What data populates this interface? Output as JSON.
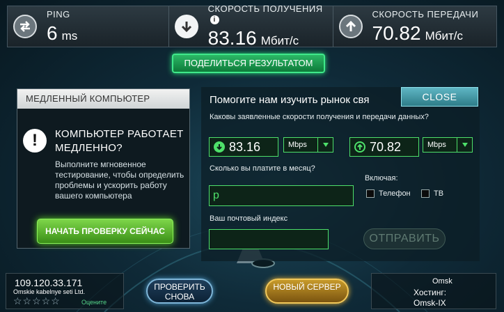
{
  "top": {
    "ping": {
      "label": "PING",
      "value": "6",
      "unit": "ms"
    },
    "download": {
      "label": "СКОРОСТЬ ПОЛУЧЕНИЯ",
      "value": "83.16",
      "unit": "Мбит/с",
      "info": "i"
    },
    "upload": {
      "label": "СКОРОСТЬ ПЕРЕДАЧИ",
      "value": "70.82",
      "unit": "Мбит/с"
    }
  },
  "share_label": "ПОДЕЛИТЬСЯ РЕЗУЛЬТАТОМ",
  "slow_panel": {
    "header": "МЕДЛЕННЫЙ КОМПЬЮТЕР",
    "alert_glyph": "!",
    "title": "КОМПЬЮТЕР РАБОТАЕТ МЕДЛЕННО?",
    "description": "Выполните мгновенное тестирование, чтобы определить проблемы и ускорить работу вашего компьютера",
    "button": "НАЧАТЬ ПРОВЕРКУ СЕЙЧАС"
  },
  "survey": {
    "title": "Помогите нам изучить рынок свя",
    "close_label": "CLOSE",
    "question_speeds": "Каковы заявленные скорости получения и передачи данных?",
    "download_value": "83.16",
    "download_unit": "Mbps",
    "upload_value": "70.82",
    "upload_unit": "Mbps",
    "question_pay": "Сколько вы платите в месяц?",
    "pay_value": "р",
    "includes_label": "Включая:",
    "phone_label": "Телефон",
    "tv_label": "ТВ",
    "question_zip": "Ваш почтовый индекс",
    "zip_value": "",
    "submit_label": "ОТПРАВИТЬ"
  },
  "bottom": {
    "ip": "109.120.33.171",
    "isp": "Omskie kabelnye seti Ltd.",
    "stars": "☆☆☆☆☆",
    "rate_label": "Оцените",
    "test_again": "ПРОВЕРИТЬ СНОВА",
    "new_server": "НОВЫЙ СЕРВЕР",
    "server_city": "Omsk",
    "hosting_label": "Хостинг:",
    "server_name": "Omsk-IX"
  },
  "colors": {
    "accent_green": "#4ee06a",
    "share_green": "#2bb866",
    "close_teal": "#5fb6c4",
    "new_server_gold": "#c79a2a"
  }
}
